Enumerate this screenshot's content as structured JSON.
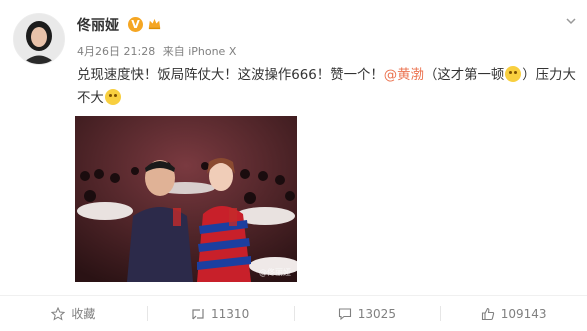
{
  "user": {
    "name": "佟丽娅",
    "verified_badge": "V",
    "member_icon": "crown-icon"
  },
  "meta": {
    "time": "4月26日 21:28",
    "source": "来自 iPhone X"
  },
  "post": {
    "text_1": "兑现速度快！饭局阵仗大！这波操作666！赞一个！",
    "mention": "@黄渤",
    "text_2": "（这才第一顿",
    "emoji_1": "smirk-emoji",
    "text_3": "）压力大不大",
    "emoji_2": "laugh-emoji",
    "image_watermark": "@佟丽娅"
  },
  "actions": {
    "favorite_label": "收藏",
    "repost_count": "11310",
    "comment_count": "13025",
    "like_count": "109143"
  },
  "colors": {
    "mention": "#eb7350",
    "badge": "#f5a623",
    "meta_text": "#808080"
  }
}
